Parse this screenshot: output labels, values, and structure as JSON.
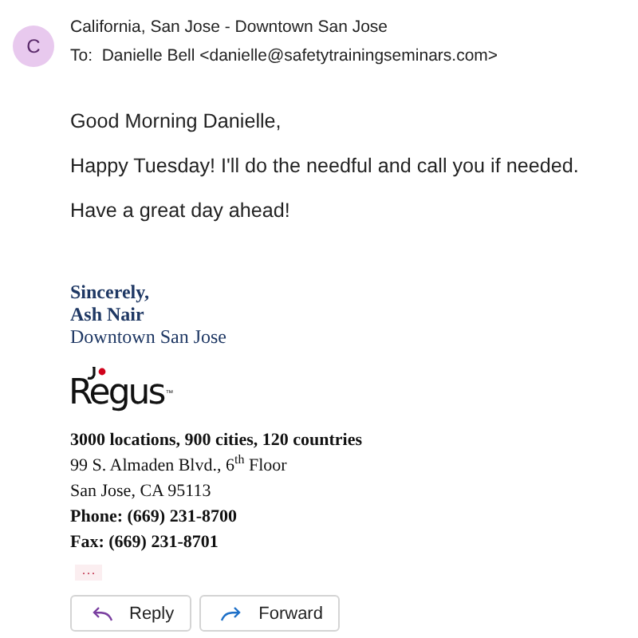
{
  "header": {
    "avatar": "C",
    "sender": "California, San Jose - Downtown San Jose",
    "to_label": "To:",
    "to": "Danielle Bell <danielle@safetytrainingseminars.com>"
  },
  "body": [
    "Good Morning Danielle,",
    "Happy Tuesday! I'll do the needful and call you if needed.",
    "Have a great day ahead!"
  ],
  "signature": [
    {
      "text": "Sincerely,",
      "bold": true
    },
    {
      "text": "Ash Nair",
      "bold": true
    },
    {
      "text": "Downtown San Jose",
      "bold": false
    }
  ],
  "logo": {
    "name": "Regus",
    "mark": "™"
  },
  "details": [
    {
      "text": "3000 locations, 900 cities, 120 countries",
      "bold": true
    },
    {
      "text": "99 S. Almaden Blvd., 6$^{th}$ Floor",
      "bold": false
    },
    {
      "text": "San Jose, CA 95113",
      "bold": false
    },
    {
      "text": "Phone: (669) 231-8700",
      "bold": true
    },
    {
      "text": "Fax: (669) 231-8701",
      "bold": true
    }
  ],
  "more": "···",
  "actions": [
    {
      "kind": "reply",
      "label": "Reply"
    },
    {
      "kind": "forward",
      "label": "Forward"
    }
  ]
}
